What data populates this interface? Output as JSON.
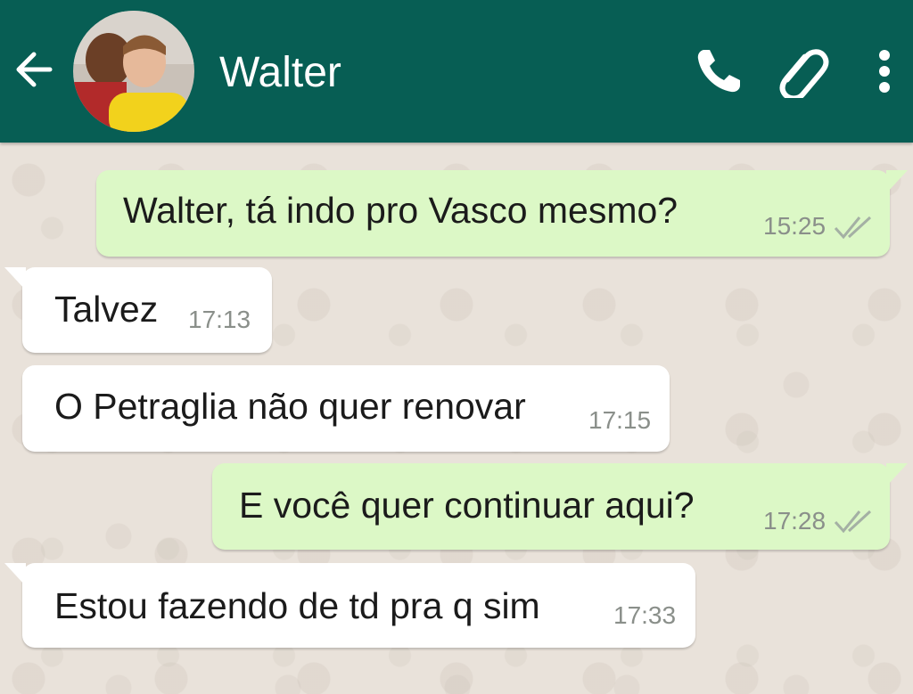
{
  "header": {
    "title": "Walter",
    "color": "#075e54",
    "icons": [
      "back-arrow-icon",
      "phone-icon",
      "paperclip-icon",
      "more-vert-icon"
    ]
  },
  "colors": {
    "sent_bubble": "#dcf8c6",
    "received_bubble": "#ffffff",
    "background": "#e9e2da"
  },
  "messages": [
    {
      "direction": "sent",
      "text": "Walter, tá indo pro Vasco mesmo?",
      "time": "15:25",
      "status": "read-double-check"
    },
    {
      "direction": "received",
      "text": "Talvez",
      "time": "17:13"
    },
    {
      "direction": "received",
      "text": "O Petraglia não quer renovar",
      "time": "17:15"
    },
    {
      "direction": "sent",
      "text": "E você quer continuar aqui?",
      "time": "17:28",
      "status": "read-double-check"
    },
    {
      "direction": "received",
      "text": "Estou fazendo de td pra q sim",
      "time": "17:33"
    }
  ]
}
